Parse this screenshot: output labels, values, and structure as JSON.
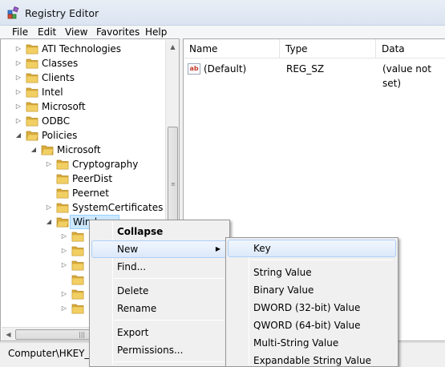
{
  "window": {
    "title": "Registry Editor"
  },
  "menubar": {
    "items": [
      "File",
      "Edit",
      "View",
      "Favorites",
      "Help"
    ]
  },
  "tree": {
    "items": [
      {
        "label": "ATI Technologies",
        "level": 1,
        "arrow": "▷",
        "open": false
      },
      {
        "label": "Classes",
        "level": 1,
        "arrow": "▷",
        "open": false
      },
      {
        "label": "Clients",
        "level": 1,
        "arrow": "▷",
        "open": false
      },
      {
        "label": "Intel",
        "level": 1,
        "arrow": "▷",
        "open": false
      },
      {
        "label": "Microsoft",
        "level": 1,
        "arrow": "▷",
        "open": false
      },
      {
        "label": "ODBC",
        "level": 1,
        "arrow": "▷",
        "open": false
      },
      {
        "label": "Policies",
        "level": 1,
        "arrow": "◢",
        "open": true
      },
      {
        "label": "Microsoft",
        "level": 2,
        "arrow": "◢",
        "open": true
      },
      {
        "label": "Cryptography",
        "level": 3,
        "arrow": "▷",
        "open": false
      },
      {
        "label": "PeerDist",
        "level": 3,
        "arrow": "",
        "open": false
      },
      {
        "label": "Peernet",
        "level": 3,
        "arrow": "",
        "open": false
      },
      {
        "label": "SystemCertificates",
        "level": 3,
        "arrow": "▷",
        "open": false
      },
      {
        "label": "Windows",
        "level": 3,
        "arrow": "◢",
        "open": true,
        "selected": true
      },
      {
        "label": "",
        "level": 4,
        "arrow": "▷",
        "open": false
      },
      {
        "label": "",
        "level": 4,
        "arrow": "▷",
        "open": false
      },
      {
        "label": "",
        "level": 4,
        "arrow": "▷",
        "open": false
      },
      {
        "label": "",
        "level": 4,
        "arrow": "",
        "open": false
      },
      {
        "label": "",
        "level": 4,
        "arrow": "▷",
        "open": false
      },
      {
        "label": "",
        "level": 4,
        "arrow": "▷",
        "open": false
      }
    ]
  },
  "list": {
    "columns": [
      "Name",
      "Type",
      "Data"
    ],
    "rows": [
      {
        "icon": "ab",
        "name": "(Default)",
        "type": "REG_SZ",
        "data": "(value not set)"
      }
    ]
  },
  "status": {
    "path": "Computer\\HKEY_LOCAL_MACHINE\\SOFTWARE\\Policies\\Microsoft\\Windows"
  },
  "context_menu": {
    "items": [
      {
        "label": "Collapse",
        "bold": true
      },
      {
        "label": "New",
        "submenu": true,
        "hover": true
      },
      {
        "label": "Find..."
      },
      {
        "separator": true
      },
      {
        "label": "Delete"
      },
      {
        "label": "Rename"
      },
      {
        "separator": true
      },
      {
        "label": "Export"
      },
      {
        "label": "Permissions..."
      },
      {
        "separator": true
      }
    ]
  },
  "submenu": {
    "items": [
      {
        "label": "Key",
        "hover": true
      },
      {
        "separator": true
      },
      {
        "label": "String Value"
      },
      {
        "label": "Binary Value"
      },
      {
        "label": "DWORD (32-bit) Value"
      },
      {
        "label": "QWORD (64-bit) Value"
      },
      {
        "label": "Multi-String Value"
      },
      {
        "label": "Expandable String Value"
      }
    ]
  },
  "colors": {
    "folder": "#f2cf63",
    "selection": "#cce8ff",
    "menu_hover": "#dce9fa"
  }
}
